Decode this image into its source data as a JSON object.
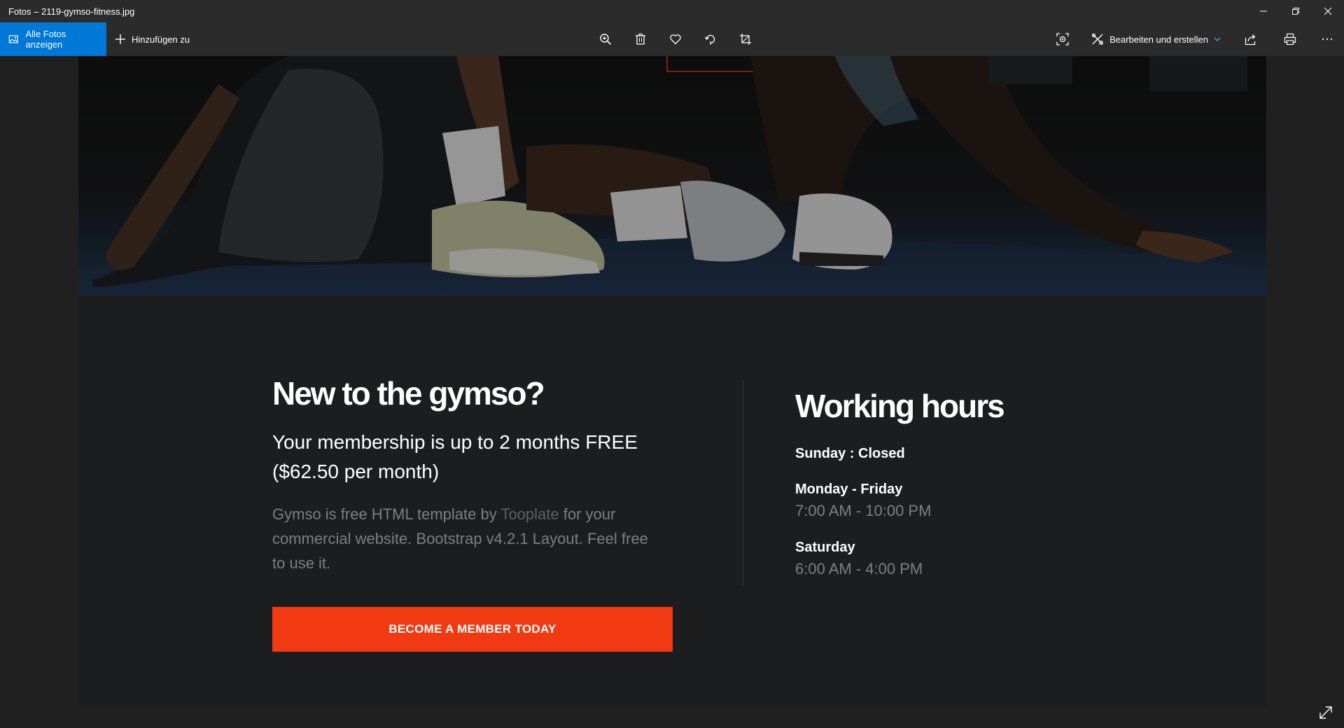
{
  "window": {
    "title": "Fotos – 2119-gymso-fitness.jpg"
  },
  "toolbar": {
    "all_photos_label": "Alle Fotos anzeigen",
    "add_to_label": "Hinzufügen zu",
    "edit_create_label": "Bearbeiten und erstellen",
    "icons": [
      "zoom-icon",
      "delete-icon",
      "favorite-icon",
      "rotate-icon",
      "crop-icon",
      "visual-search-icon",
      "edit-icon",
      "share-icon",
      "print-icon",
      "more-icon"
    ]
  },
  "photo": {
    "heading_new": "New to the gymso?",
    "membership_text": "Your membership is up to 2 months FREE ($62.50 per month)",
    "desc_before": "Gymso is free HTML template by ",
    "desc_link": "Tooplate",
    "desc_after": " for your commercial website. Bootstrap v4.2.1 Layout. Feel free to use it.",
    "cta_label": "BECOME A MEMBER TODAY",
    "heading_hours": "Working hours",
    "hours": [
      {
        "day": "Sunday : Closed",
        "time": ""
      },
      {
        "day": "Monday - Friday",
        "time": "7:00 AM - 10:00 PM"
      },
      {
        "day": "Saturday",
        "time": "6:00 AM - 4:00 PM"
      }
    ]
  },
  "colors": {
    "accent_blue": "#0078d7",
    "cta_orange": "#f13a11",
    "app_bg": "#202020",
    "chrome_bg": "#2b2b2b"
  }
}
